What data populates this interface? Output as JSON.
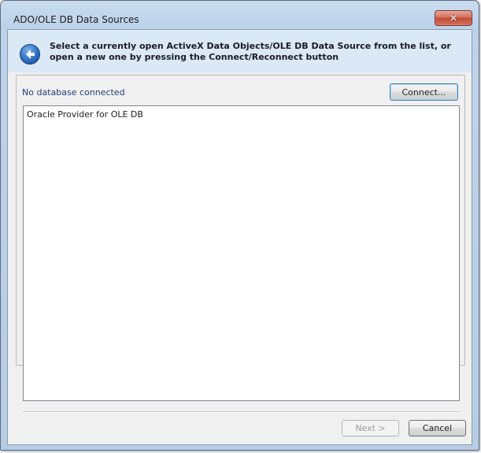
{
  "window": {
    "title": "ADO/OLE DB Data Sources",
    "close_symbol": "✕"
  },
  "header": {
    "back_icon": "back-arrow-icon",
    "instruction": "Select a currently open ActiveX Data Objects/OLE DB Data Source from the list, or open a new one by pressing the Connect/Reconnect button"
  },
  "status": {
    "text": "No database connected"
  },
  "buttons": {
    "connect_label": "Connect...",
    "next_label": "Next >",
    "cancel_label": "Cancel"
  },
  "list": {
    "items": [
      {
        "label": "Oracle Provider for OLE DB"
      }
    ]
  },
  "colors": {
    "title_gradient_top": "#c9dcef",
    "header_band": "#dbe8f6",
    "status_text": "#1c3f7a",
    "close_button": "#c14a35"
  }
}
